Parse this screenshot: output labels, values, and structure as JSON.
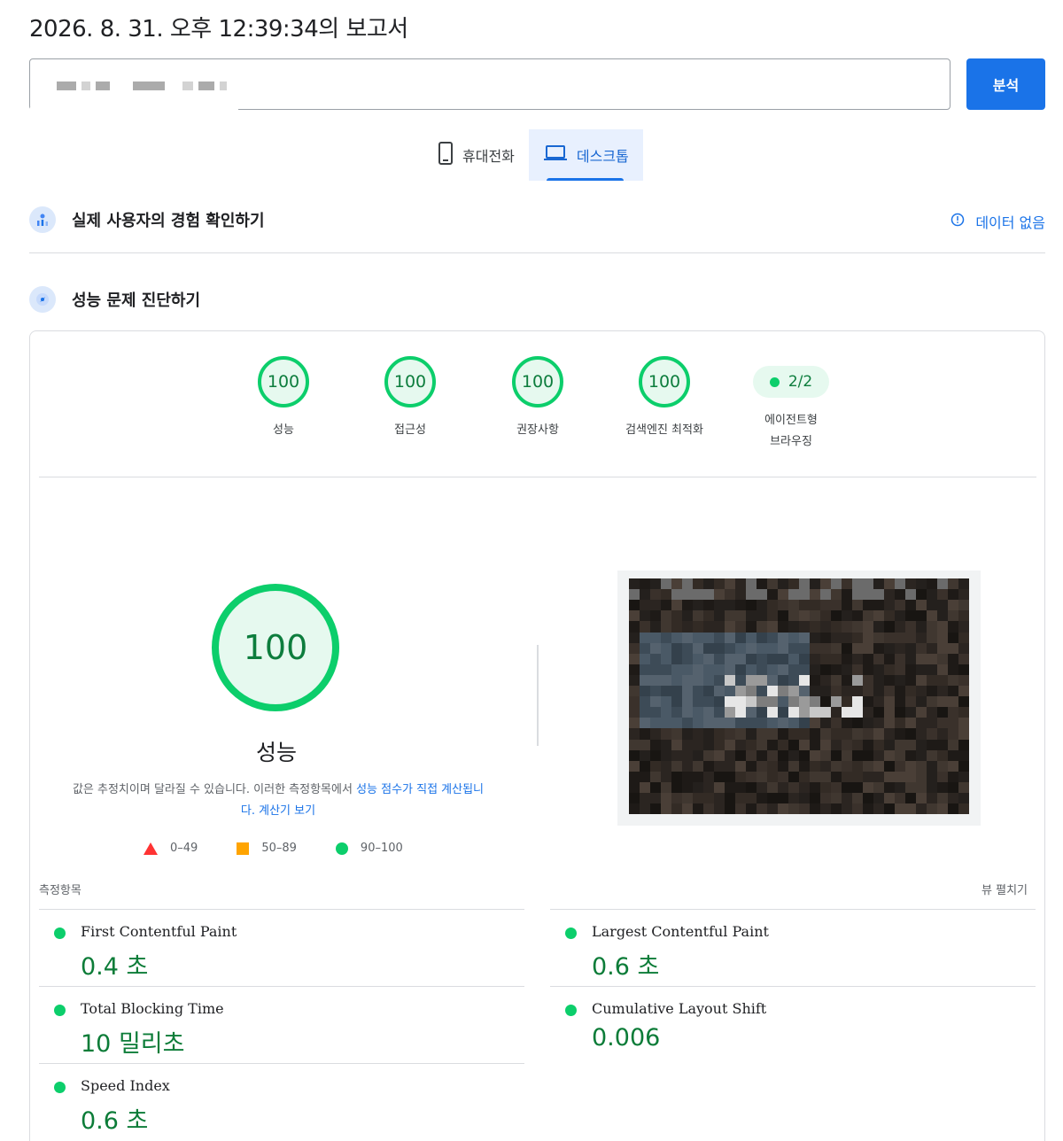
{
  "report": {
    "title": "2026. 8. 31. 오후 12:39:34의 보고서"
  },
  "url_input": {
    "value": ""
  },
  "toolbar": {
    "analyze_label": "분석"
  },
  "tabs": [
    {
      "label": "휴대전화",
      "icon": "phone-icon",
      "active": false
    },
    {
      "label": "데스크톱",
      "icon": "laptop-icon",
      "active": true
    }
  ],
  "field_data": {
    "title": "실제 사용자의 경험 확인하기",
    "status": "데이터 없음"
  },
  "diagnose": {
    "title": "성능 문제 진단하기"
  },
  "categories": [
    {
      "label": "성능",
      "score": "100"
    },
    {
      "label": "접근성",
      "score": "100"
    },
    {
      "label": "권장사항",
      "score": "100"
    },
    {
      "label": "검색엔진 최적화",
      "score": "100"
    }
  ],
  "agentic": {
    "label_line1": "에이전트형",
    "label_line2": "브라우징",
    "value": "2/2"
  },
  "performance": {
    "score": "100",
    "label": "성능",
    "desc_text": "값은 추정치이며 달라질 수 있습니다. 이러한 측정항목에서 ",
    "desc_link": "성능 점수가 직접 계산됩니다.",
    "calc_link": "계산기 보기"
  },
  "legend": [
    {
      "range": "0–49",
      "color": "#ff3333"
    },
    {
      "range": "50–89",
      "color": "#ffa400"
    },
    {
      "range": "90–100",
      "color": "#0cce6b"
    }
  ],
  "metrics_section": {
    "title": "측정항목",
    "expand": "뷰 펼치기"
  },
  "metrics": [
    {
      "name": "First Contentful Paint",
      "value": "0.4 초"
    },
    {
      "name": "Largest Contentful Paint",
      "value": "0.6 초"
    },
    {
      "name": "Total Blocking Time",
      "value": "10 밀리초"
    },
    {
      "name": "Cumulative Layout Shift",
      "value": "0.006"
    },
    {
      "name": "Speed Index",
      "value": "0.6 초"
    }
  ],
  "colors": {
    "pass": "#0cce6b",
    "pass_text": "#0c7c38",
    "accent": "#1a73e8"
  }
}
